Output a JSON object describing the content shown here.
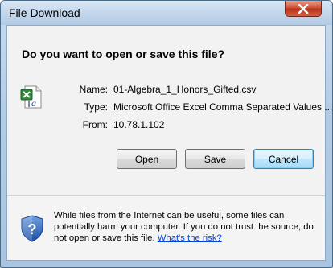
{
  "window": {
    "title": "File Download",
    "close_icon": "close-x-icon"
  },
  "dialog": {
    "question": "Do you want to open or save this file?",
    "file_icon": "excel-csv-file-icon",
    "name_label": "Name:",
    "name_value": "01-Algebra_1_Honors_Gifted.csv",
    "type_label": "Type:",
    "type_value": "Microsoft Office Excel Comma Separated Values ...",
    "from_label": "From:",
    "from_value": "10.78.1.102"
  },
  "buttons": {
    "open_label": "Open",
    "save_label": "Save",
    "cancel_label": "Cancel"
  },
  "warning": {
    "shield_icon": "security-shield-question-icon",
    "text": "While files from the Internet can be useful, some files can potentially harm your computer. If you do not trust the source, do not open or save this file.",
    "link_text": "What's the risk?"
  },
  "colors": {
    "title_bar": "#c3d7ec",
    "close_button": "#d0533a",
    "link": "#0645d6",
    "default_button_border": "#3c7fb1"
  }
}
